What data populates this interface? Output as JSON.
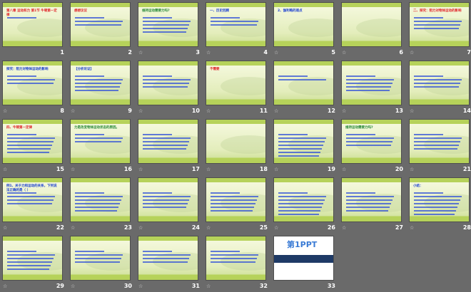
{
  "window": {
    "view": "slide-sorter"
  },
  "colors": {
    "background": "#6a6a6a",
    "slide_bar": "#b6d25a",
    "text_blue": "#1a3fd0",
    "text_red": "#e0262a"
  },
  "transition_icon": "star-icon",
  "slides": [
    {
      "number": "1",
      "title": "第八章 运动和力 第1节 牛顿第一定律",
      "color": "red",
      "lines": 1
    },
    {
      "number": "2",
      "title": "想想议议",
      "color": "red",
      "lines": 3
    },
    {
      "number": "3",
      "title": "维持运动需要力吗?",
      "color": "green",
      "lines": 5
    },
    {
      "number": "4",
      "title": "一、历史回顾",
      "color": "blue",
      "lines": 3
    },
    {
      "number": "5",
      "title": "2、伽利略的观点",
      "color": "blue",
      "lines": 0
    },
    {
      "number": "6",
      "title": "",
      "color": "blue",
      "lines": 0
    },
    {
      "number": "7",
      "title": "二、探究：阻力对物体运动的影响",
      "color": "red",
      "lines": 4
    },
    {
      "number": "8",
      "title": "探究：阻力对物体运动的影响",
      "color": "blue",
      "lines": 3
    },
    {
      "number": "9",
      "title": "【分析论证】",
      "color": "blue",
      "lines": 5
    },
    {
      "number": "10",
      "title": "",
      "color": "blue",
      "lines": 4
    },
    {
      "number": "11",
      "title": "不需要",
      "color": "red",
      "lines": 0
    },
    {
      "number": "12",
      "title": "",
      "color": "blue",
      "lines": 2
    },
    {
      "number": "13",
      "title": "",
      "color": "blue",
      "lines": 5
    },
    {
      "number": "14",
      "title": "",
      "color": "blue",
      "lines": 4
    },
    {
      "number": "15",
      "title": "四、牛顿第一定律",
      "color": "red",
      "lines": 6
    },
    {
      "number": "16",
      "title": "力是改变物体运动状态的原因。",
      "color": "green",
      "lines": 3
    },
    {
      "number": "17",
      "title": "",
      "color": "blue",
      "lines": 5
    },
    {
      "number": "18",
      "title": "",
      "color": "red",
      "lines": 0
    },
    {
      "number": "19",
      "title": "",
      "color": "blue",
      "lines": 7
    },
    {
      "number": "20",
      "title": "维持运动需要力吗?",
      "color": "green",
      "lines": 4
    },
    {
      "number": "21",
      "title": "",
      "color": "blue",
      "lines": 5
    },
    {
      "number": "22",
      "title": "例1、关于力和运动的关系，下列说法正确的是（ ）",
      "color": "blue",
      "lines": 4
    },
    {
      "number": "23",
      "title": "",
      "color": "blue",
      "lines": 6
    },
    {
      "number": "24",
      "title": "",
      "color": "blue",
      "lines": 5
    },
    {
      "number": "25",
      "title": "",
      "color": "blue",
      "lines": 6
    },
    {
      "number": "26",
      "title": "",
      "color": "blue",
      "lines": 7
    },
    {
      "number": "27",
      "title": "",
      "color": "blue",
      "lines": 6
    },
    {
      "number": "28",
      "title": "小结：",
      "color": "blue",
      "lines": 7
    },
    {
      "number": "29",
      "title": "",
      "color": "blue",
      "lines": 6
    },
    {
      "number": "30",
      "title": "",
      "color": "blue",
      "lines": 4
    },
    {
      "number": "31",
      "title": "",
      "color": "blue",
      "lines": 4
    },
    {
      "number": "32",
      "title": "",
      "color": "blue",
      "lines": 4
    },
    {
      "number": "33",
      "title": "第1PPT",
      "color": "blue",
      "lines": 0
    }
  ]
}
